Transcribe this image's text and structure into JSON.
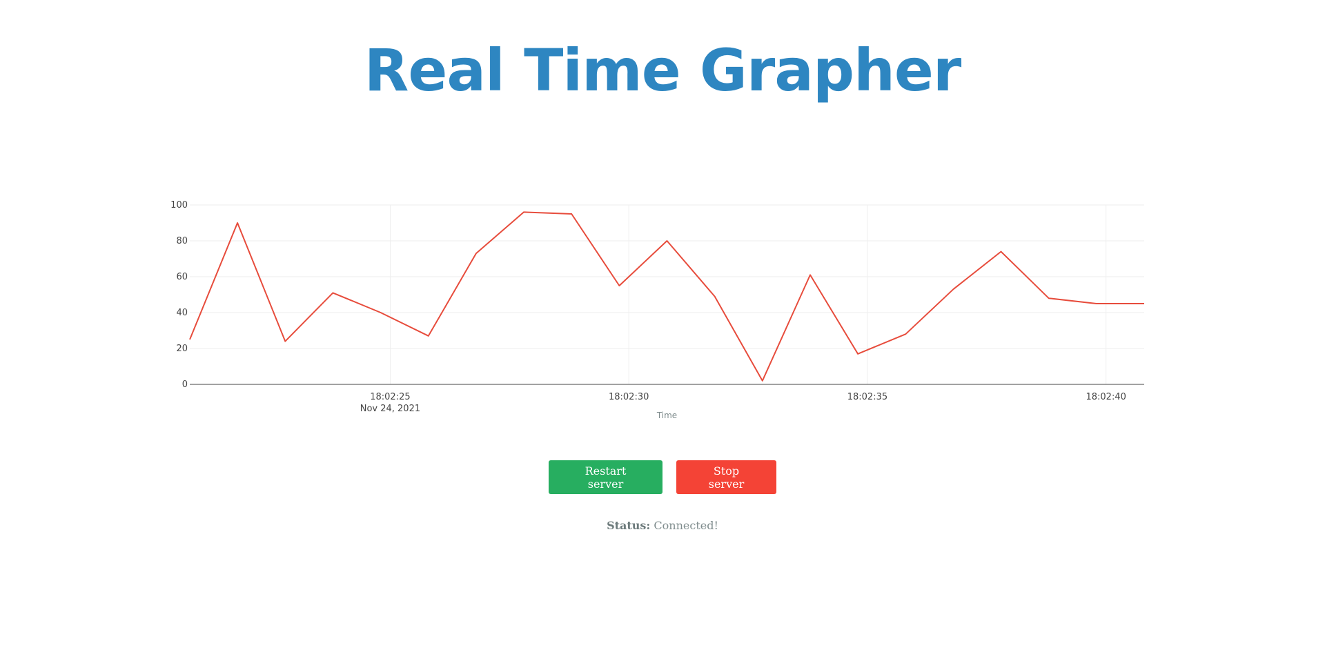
{
  "header": {
    "title": "Real Time Grapher"
  },
  "chart_data": {
    "type": "line",
    "title": "",
    "xlabel": "Time",
    "ylabel": "",
    "ylim": [
      0,
      100
    ],
    "yticks": [
      0,
      20,
      40,
      60,
      80,
      100
    ],
    "date_label": "Nov 24, 2021",
    "xlim": [
      "18:02:20.8",
      "18:02:40.8"
    ],
    "xticks": [
      "18:02:25",
      "18:02:30",
      "18:02:35",
      "18:02:40"
    ],
    "grid": true,
    "series": [
      {
        "color": "#e74c3c",
        "x": [
          "18:02:20.8",
          "18:02:21.8",
          "18:02:22.8",
          "18:02:23.8",
          "18:02:24.8",
          "18:02:25.8",
          "18:02:26.8",
          "18:02:27.8",
          "18:02:28.8",
          "18:02:29.8",
          "18:02:30.8",
          "18:02:31.8",
          "18:02:32.8",
          "18:02:33.8",
          "18:02:34.8",
          "18:02:35.8",
          "18:02:36.8",
          "18:02:37.8",
          "18:02:38.8",
          "18:02:39.8",
          "18:02:40.8"
        ],
        "values": [
          25,
          90,
          24,
          51,
          40,
          27,
          73,
          96,
          95,
          55,
          80,
          49,
          2,
          61,
          17,
          28,
          53,
          74,
          48,
          45,
          45
        ]
      }
    ]
  },
  "controls": {
    "restart_label": "Restart server",
    "stop_label": "Stop server"
  },
  "status": {
    "label": "Status:",
    "value": "Connected!"
  },
  "colors": {
    "title": "#2e86c1",
    "line": "#e74c3c",
    "restart": "#27ae60",
    "stop": "#f44336"
  }
}
